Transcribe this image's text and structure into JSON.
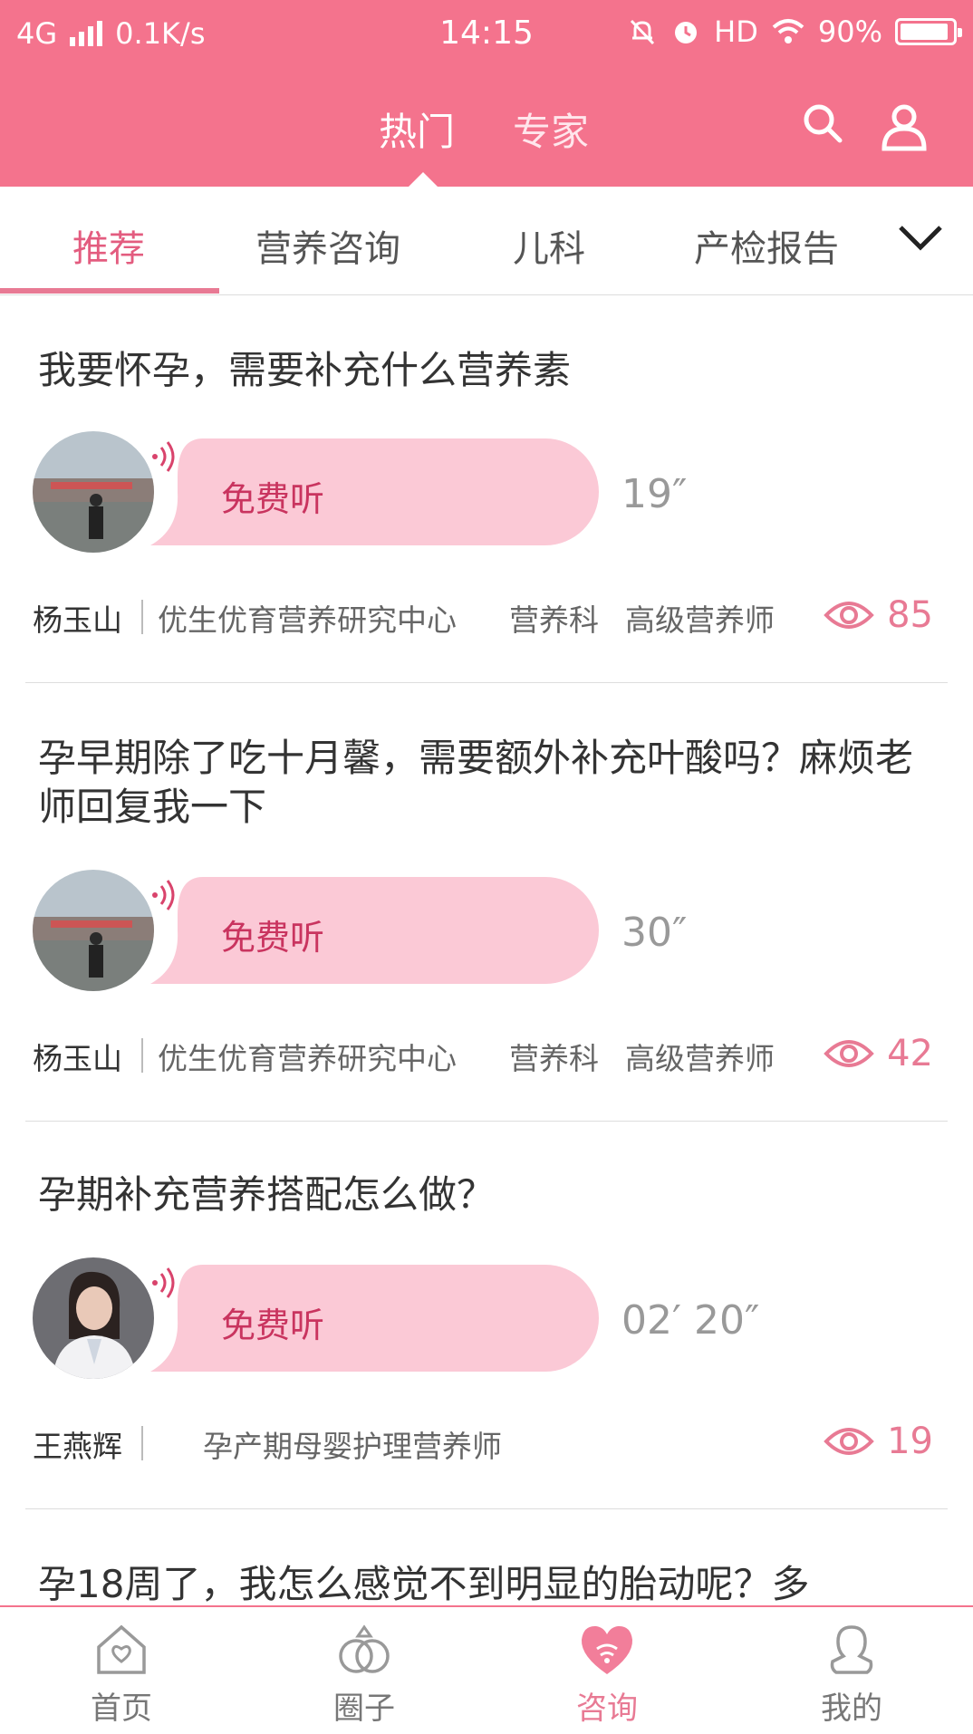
{
  "status_bar": {
    "network": "4G",
    "speed": "0.1K/s",
    "time": "14:15",
    "hd": "HD",
    "battery": "90%"
  },
  "header": {
    "tabs": [
      {
        "label": "热门",
        "active": true
      },
      {
        "label": "专家",
        "active": false
      }
    ],
    "icons": [
      "search-icon",
      "profile-icon"
    ]
  },
  "categories": {
    "items": [
      "推荐",
      "营养咨询",
      "儿科",
      "产检报告"
    ],
    "active": "推荐"
  },
  "feed": [
    {
      "question": "我要怀孕，需要补充什么营养素",
      "listen_label": "免费听",
      "duration": "19″",
      "expert_name": "杨玉山",
      "institution": "优生优育营养研究中心",
      "department": "营养科",
      "title": "高级营养师",
      "views": "85"
    },
    {
      "question": "孕早期除了吃十月馨，需要额外补充叶酸吗？麻烦老师回复我一下",
      "listen_label": "免费听",
      "duration": "30″",
      "expert_name": "杨玉山",
      "institution": "优生优育营养研究中心",
      "department": "营养科",
      "title": "高级营养师",
      "views": "42"
    },
    {
      "question": "孕期补充营养搭配怎么做？",
      "listen_label": "免费听",
      "duration": "02′ 20″",
      "expert_name": "王燕辉",
      "title": "孕产期母婴护理营养师",
      "views": "19"
    },
    {
      "question": "孕18周了，我怎么感觉不到明显的胎动呢？多"
    }
  ],
  "bottom_nav": [
    {
      "label": "首页",
      "icon": "home-icon",
      "active": false
    },
    {
      "label": "圈子",
      "icon": "rings-icon",
      "active": false
    },
    {
      "label": "咨询",
      "icon": "consult-heart-icon",
      "active": true
    },
    {
      "label": "我的",
      "icon": "user-icon",
      "active": false
    }
  ],
  "colors": {
    "brand_pink": "#F4738D",
    "accent_pink": "#E87A94",
    "bubble_pink": "#FBC9D6"
  }
}
